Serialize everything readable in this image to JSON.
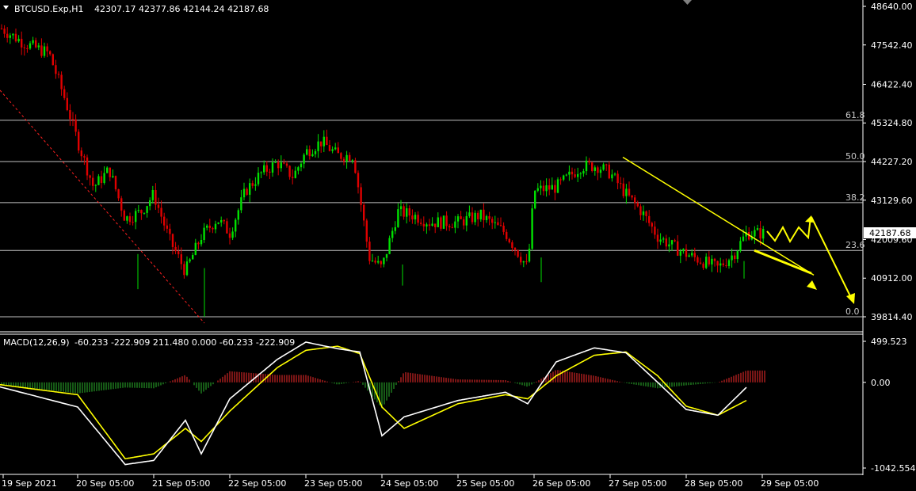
{
  "header": {
    "symbol_tf": "BTCUSD.Exp,H1",
    "ohlc": "42307.17 42377.86 42144.24 42187.68",
    "dropdown_icon": "triangle-down-icon"
  },
  "macd_header": {
    "label": "MACD(12,26,9)",
    "values": "-60.233 -222.909 211.480 0.000 -60.233 -222.909"
  },
  "price_axis": {
    "ticks": [
      {
        "label": "48640.00",
        "value": 48640.0
      },
      {
        "label": "47542.40",
        "value": 47542.4
      },
      {
        "label": "46422.40",
        "value": 46422.4
      },
      {
        "label": "45324.80",
        "value": 45324.8
      },
      {
        "label": "44227.20",
        "value": 44227.2
      },
      {
        "label": "43129.60",
        "value": 43129.6
      },
      {
        "label": "42009.60",
        "value": 42009.6
      },
      {
        "label": "40912.00",
        "value": 40912.0
      },
      {
        "label": "39814.40",
        "value": 39814.4
      }
    ],
    "current_price": "42187.68"
  },
  "macd_axis": {
    "ticks": [
      {
        "label": "499.523",
        "value": 499.523
      },
      {
        "label": "0.00",
        "value": 0
      },
      {
        "label": "-1042.554",
        "value": -1042.554
      }
    ]
  },
  "time_axis": {
    "labels": [
      "19 Sep 2021",
      "20 Sep 05:00",
      "21 Sep 05:00",
      "22 Sep 05:00",
      "23 Sep 05:00",
      "24 Sep 05:00",
      "25 Sep 05:00",
      "26 Sep 05:00",
      "27 Sep 05:00",
      "28 Sep 05:00",
      "29 Sep 05:00"
    ]
  },
  "fibonacci": [
    {
      "level": "61.8",
      "value": 45400
    },
    {
      "level": "50.0",
      "value": 44227
    },
    {
      "level": "38.2",
      "value": 43060
    },
    {
      "level": "23.6",
      "value": 41700
    },
    {
      "level": "0.0",
      "value": 39814
    }
  ],
  "colors": {
    "background": "#000000",
    "bull": "#00e000",
    "bear": "#e00000",
    "grid_text": "#ffffff",
    "fib_line": "#c0c0c0",
    "macd_line": "#ffffff",
    "signal_line": "#ffff00",
    "hist_pos": "#b02020",
    "hist_neg": "#208020",
    "annotation": "#ffff00",
    "trend_dotted": "#ff2020"
  },
  "chart_data": {
    "type": "candlestick",
    "symbol": "BTCUSD.Exp",
    "timeframe": "H1",
    "close_path": [
      [
        "19 Sep 2021",
        48300
      ],
      [
        "19 Sep 12:00",
        47600
      ],
      [
        "19 Sep 20:00",
        47300
      ],
      [
        "20 Sep 01:00",
        46000
      ],
      [
        "20 Sep 05:00",
        44800
      ],
      [
        "20 Sep 10:00",
        43500
      ],
      [
        "20 Sep 15:00",
        44000
      ],
      [
        "20 Sep 20:00",
        42600
      ],
      [
        "21 Sep 01:00",
        42800
      ],
      [
        "21 Sep 05:00",
        43300
      ],
      [
        "21 Sep 10:00",
        42000
      ],
      [
        "21 Sep 15:00",
        41100
      ],
      [
        "21 Sep 20:00",
        42100
      ],
      [
        "22 Sep 01:00",
        42600
      ],
      [
        "22 Sep 05:00",
        42200
      ],
      [
        "22 Sep 10:00",
        43400
      ],
      [
        "22 Sep 15:00",
        43900
      ],
      [
        "22 Sep 20:00",
        44200
      ],
      [
        "23 Sep 01:00",
        43800
      ],
      [
        "23 Sep 05:00",
        44500
      ],
      [
        "23 Sep 10:00",
        44800
      ],
      [
        "23 Sep 15:00",
        44400
      ],
      [
        "23 Sep 20:00",
        44400
      ],
      [
        "24 Sep 01:00",
        41500
      ],
      [
        "24 Sep 05:00",
        41200
      ],
      [
        "24 Sep 10:00",
        42800
      ],
      [
        "24 Sep 15:00",
        42700
      ],
      [
        "24 Sep 20:00",
        42500
      ],
      [
        "25 Sep 05:00",
        42500
      ],
      [
        "25 Sep 12:00",
        42700
      ],
      [
        "25 Sep 20:00",
        42200
      ],
      [
        "26 Sep 03:00",
        41200
      ],
      [
        "26 Sep 05:00",
        43400
      ],
      [
        "26 Sep 12:00",
        43500
      ],
      [
        "26 Sep 20:00",
        44100
      ],
      [
        "27 Sep 01:00",
        44100
      ],
      [
        "27 Sep 05:00",
        43900
      ],
      [
        "27 Sep 10:00",
        43300
      ],
      [
        "27 Sep 15:00",
        42800
      ],
      [
        "27 Sep 20:00",
        42100
      ],
      [
        "28 Sep 01:00",
        41800
      ],
      [
        "28 Sep 05:00",
        41600
      ],
      [
        "28 Sep 10:00",
        41400
      ],
      [
        "28 Sep 15:00",
        41200
      ],
      [
        "28 Sep 20:00",
        41600
      ],
      [
        "29 Sep 00:00",
        42190
      ]
    ],
    "macd_path": [
      [
        "19 Sep 2021",
        -10
      ],
      [
        "20 Sep 05:00",
        -300
      ],
      [
        "20 Sep 20:00",
        -1000
      ],
      [
        "21 Sep 05:00",
        -950
      ],
      [
        "21 Sep 15:00",
        -460
      ],
      [
        "21 Sep 20:00",
        -870
      ],
      [
        "22 Sep 05:00",
        -200
      ],
      [
        "22 Sep 20:00",
        280
      ],
      [
        "23 Sep 05:00",
        490
      ],
      [
        "23 Sep 15:00",
        410
      ],
      [
        "23 Sep 22:00",
        370
      ],
      [
        "24 Sep 05:00",
        -650
      ],
      [
        "24 Sep 12:00",
        -420
      ],
      [
        "25 Sep 05:00",
        -220
      ],
      [
        "25 Sep 20:00",
        -120
      ],
      [
        "26 Sep 03:00",
        -260
      ],
      [
        "26 Sep 12:00",
        250
      ],
      [
        "27 Sep 00:00",
        420
      ],
      [
        "27 Sep 10:00",
        360
      ],
      [
        "27 Sep 20:00",
        0
      ],
      [
        "28 Sep 05:00",
        -330
      ],
      [
        "28 Sep 15:00",
        -400
      ],
      [
        "29 Sep 00:00",
        -60
      ]
    ],
    "signal_path": [
      [
        "19 Sep 2021",
        -5
      ],
      [
        "20 Sep 05:00",
        -150
      ],
      [
        "20 Sep 20:00",
        -930
      ],
      [
        "21 Sep 05:00",
        -870
      ],
      [
        "21 Sep 15:00",
        -560
      ],
      [
        "21 Sep 20:00",
        -720
      ],
      [
        "22 Sep 05:00",
        -350
      ],
      [
        "22 Sep 20:00",
        180
      ],
      [
        "23 Sep 05:00",
        390
      ],
      [
        "23 Sep 15:00",
        440
      ],
      [
        "23 Sep 22:00",
        350
      ],
      [
        "24 Sep 05:00",
        -300
      ],
      [
        "24 Sep 12:00",
        -560
      ],
      [
        "25 Sep 05:00",
        -260
      ],
      [
        "25 Sep 20:00",
        -150
      ],
      [
        "26 Sep 03:00",
        -200
      ],
      [
        "26 Sep 12:00",
        80
      ],
      [
        "27 Sep 00:00",
        330
      ],
      [
        "27 Sep 10:00",
        370
      ],
      [
        "27 Sep 20:00",
        80
      ],
      [
        "28 Sep 05:00",
        -290
      ],
      [
        "28 Sep 15:00",
        -400
      ],
      [
        "29 Sep 00:00",
        -220
      ]
    ]
  }
}
